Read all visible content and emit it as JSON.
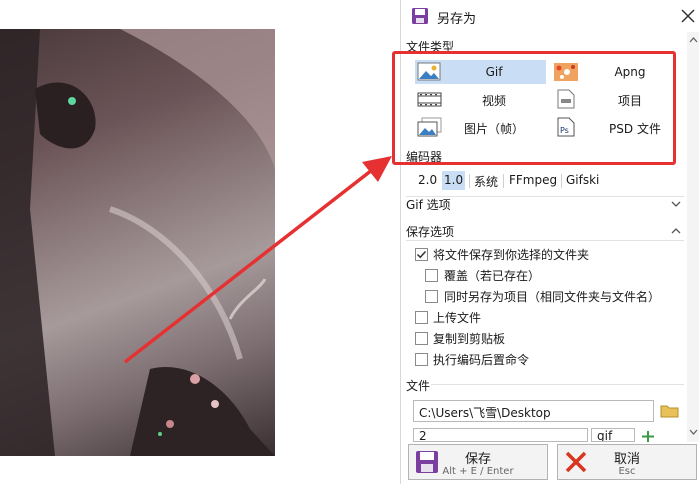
{
  "dialog": {
    "title": "另存为"
  },
  "file_type": {
    "header": "文件类型",
    "items": [
      {
        "label": "Gif",
        "selected": true
      },
      {
        "label": "Apng",
        "selected": false
      },
      {
        "label": "视频",
        "selected": false
      },
      {
        "label": "项目",
        "selected": false
      },
      {
        "label": "图片（帧）",
        "selected": false
      },
      {
        "label": "PSD 文件",
        "selected": false
      }
    ]
  },
  "encoder": {
    "header": "编码器",
    "tabs": [
      "2.0",
      "1.0",
      "系统",
      "FFmpeg",
      "Gifski"
    ],
    "selected": "1.0"
  },
  "gif_options": {
    "header": "Gif 选项"
  },
  "save_options": {
    "header": "保存选项",
    "items": [
      {
        "label": "将文件保存到你选择的文件夹",
        "checked": true
      },
      {
        "label": "覆盖（若已存在）",
        "checked": false
      },
      {
        "label": "同时另存为项目（相同文件夹与文件名）",
        "checked": false
      },
      {
        "label": "上传文件",
        "checked": false
      },
      {
        "label": "复制到剪贴板",
        "checked": false
      },
      {
        "label": "执行编码后置命令",
        "checked": false
      }
    ]
  },
  "file": {
    "header": "文件",
    "folder_path": "C:\\Users\\飞雪\\Desktop",
    "file_name": "2",
    "extension": "gif"
  },
  "buttons": {
    "save_label": "保存",
    "save_shortcut": "Alt + E / Enter",
    "cancel_label": "取消",
    "cancel_shortcut": "Esc"
  },
  "colors": {
    "highlight_box": "#e53131",
    "selection": "#c9def5",
    "arrow": "#e53131"
  }
}
